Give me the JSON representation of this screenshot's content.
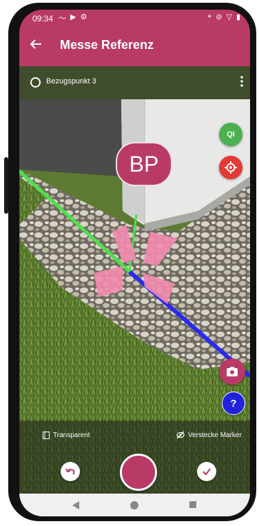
{
  "status_bar": {
    "time": "09:34"
  },
  "app_bar": {
    "title": "Messe Referenz"
  },
  "reference_point": {
    "label": "Bezugspunkt 3"
  },
  "marker": {
    "label": "BP"
  },
  "qi_button": {
    "label": "QI"
  },
  "options": {
    "transparent_label": "Transparent",
    "hide_markers_label": "Verstecke Marker"
  },
  "help_button": {
    "label": "?"
  },
  "colors": {
    "accent": "#b93a66",
    "green_button": "#4caf50",
    "red_button": "#e53935",
    "blue_button": "#2222dd",
    "x_axis": "#2a2af0",
    "y_axis": "#4ce04c"
  },
  "icons": {
    "back": "arrow-left-icon",
    "radio": "radio-unchecked-icon",
    "more": "more-vert-icon",
    "locate": "crosshair-icon",
    "camera": "camera-icon",
    "transparent": "layers-icon",
    "hide_markers": "eye-off-icon",
    "undo": "undo-icon",
    "confirm": "check-icon"
  }
}
